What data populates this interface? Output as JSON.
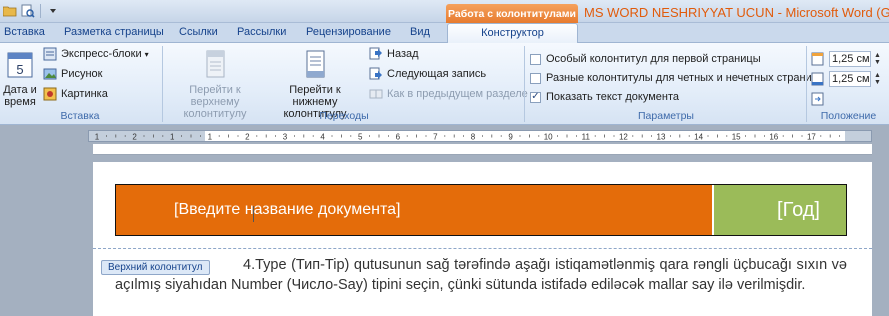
{
  "window": {
    "context_tab": "Работа с колонтитулами",
    "title": "MS WORD NESHRIYYAT UCUN  -  Microsoft Word (G"
  },
  "tabs": [
    "Вставка",
    "Разметка страницы",
    "Ссылки",
    "Рассылки",
    "Рецензирование",
    "Вид",
    "Конструктор"
  ],
  "active_tab": "Конструктор",
  "ribbon": {
    "insert_group": {
      "label": "Вставка",
      "datetime_label_1": "Дата и",
      "datetime_label_2": "время",
      "express_blocks": "Экспресс-блоки",
      "picture": "Рисунок",
      "clipart": "Картинка"
    },
    "nav_group": {
      "label": "Переходы",
      "goto_header_1": "Перейти к верхнему",
      "goto_header_2": "колонтитулу",
      "goto_footer_1": "Перейти к нижнему",
      "goto_footer_2": "колонтитулу",
      "back": "Назад",
      "next": "Следующая запись",
      "link_prev": "Как в предыдущем разделе"
    },
    "options_group": {
      "label": "Параметры",
      "different_first": {
        "text": "Особый колонтитул для первой страницы",
        "checked": false
      },
      "different_odd_even": {
        "text": "Разные колонтитулы для четных и нечетных страниц",
        "checked": false
      },
      "show_doc_text": {
        "text": "Показать текст документа",
        "checked": true
      }
    },
    "position_group": {
      "label": "Положение",
      "header_from_top": "1,25 см",
      "footer_from_bottom": "1,25 см"
    }
  },
  "ruler": {
    "labels": [
      "1",
      "2",
      "1",
      "1",
      "2",
      "3",
      "4",
      "5",
      "6",
      "7",
      "8",
      "9",
      "10",
      "11",
      "12",
      "13",
      "14",
      "15",
      "16",
      "17"
    ]
  },
  "document": {
    "header_title_placeholder": "[Введите название документа]",
    "header_year_placeholder": "[Год]",
    "header_badge": "Верхний колонтитул",
    "body_text": "4.Type (Тип-Tip) qutusunun sağ tərəfində aşağı istiqamətlənmiş qara rəngli üçbucağı sıxın və açılmış siyahıdan Number (Число-Say) tipini seçin, çünki sütunda istifadə ediləcək mallar say ilə verilmişdir."
  },
  "colors": {
    "header_title_bg": "#e46c0a",
    "header_year_bg": "#9bbb59",
    "context_tab_bg": "#e77b2f",
    "title_text": "#e15b0b"
  }
}
